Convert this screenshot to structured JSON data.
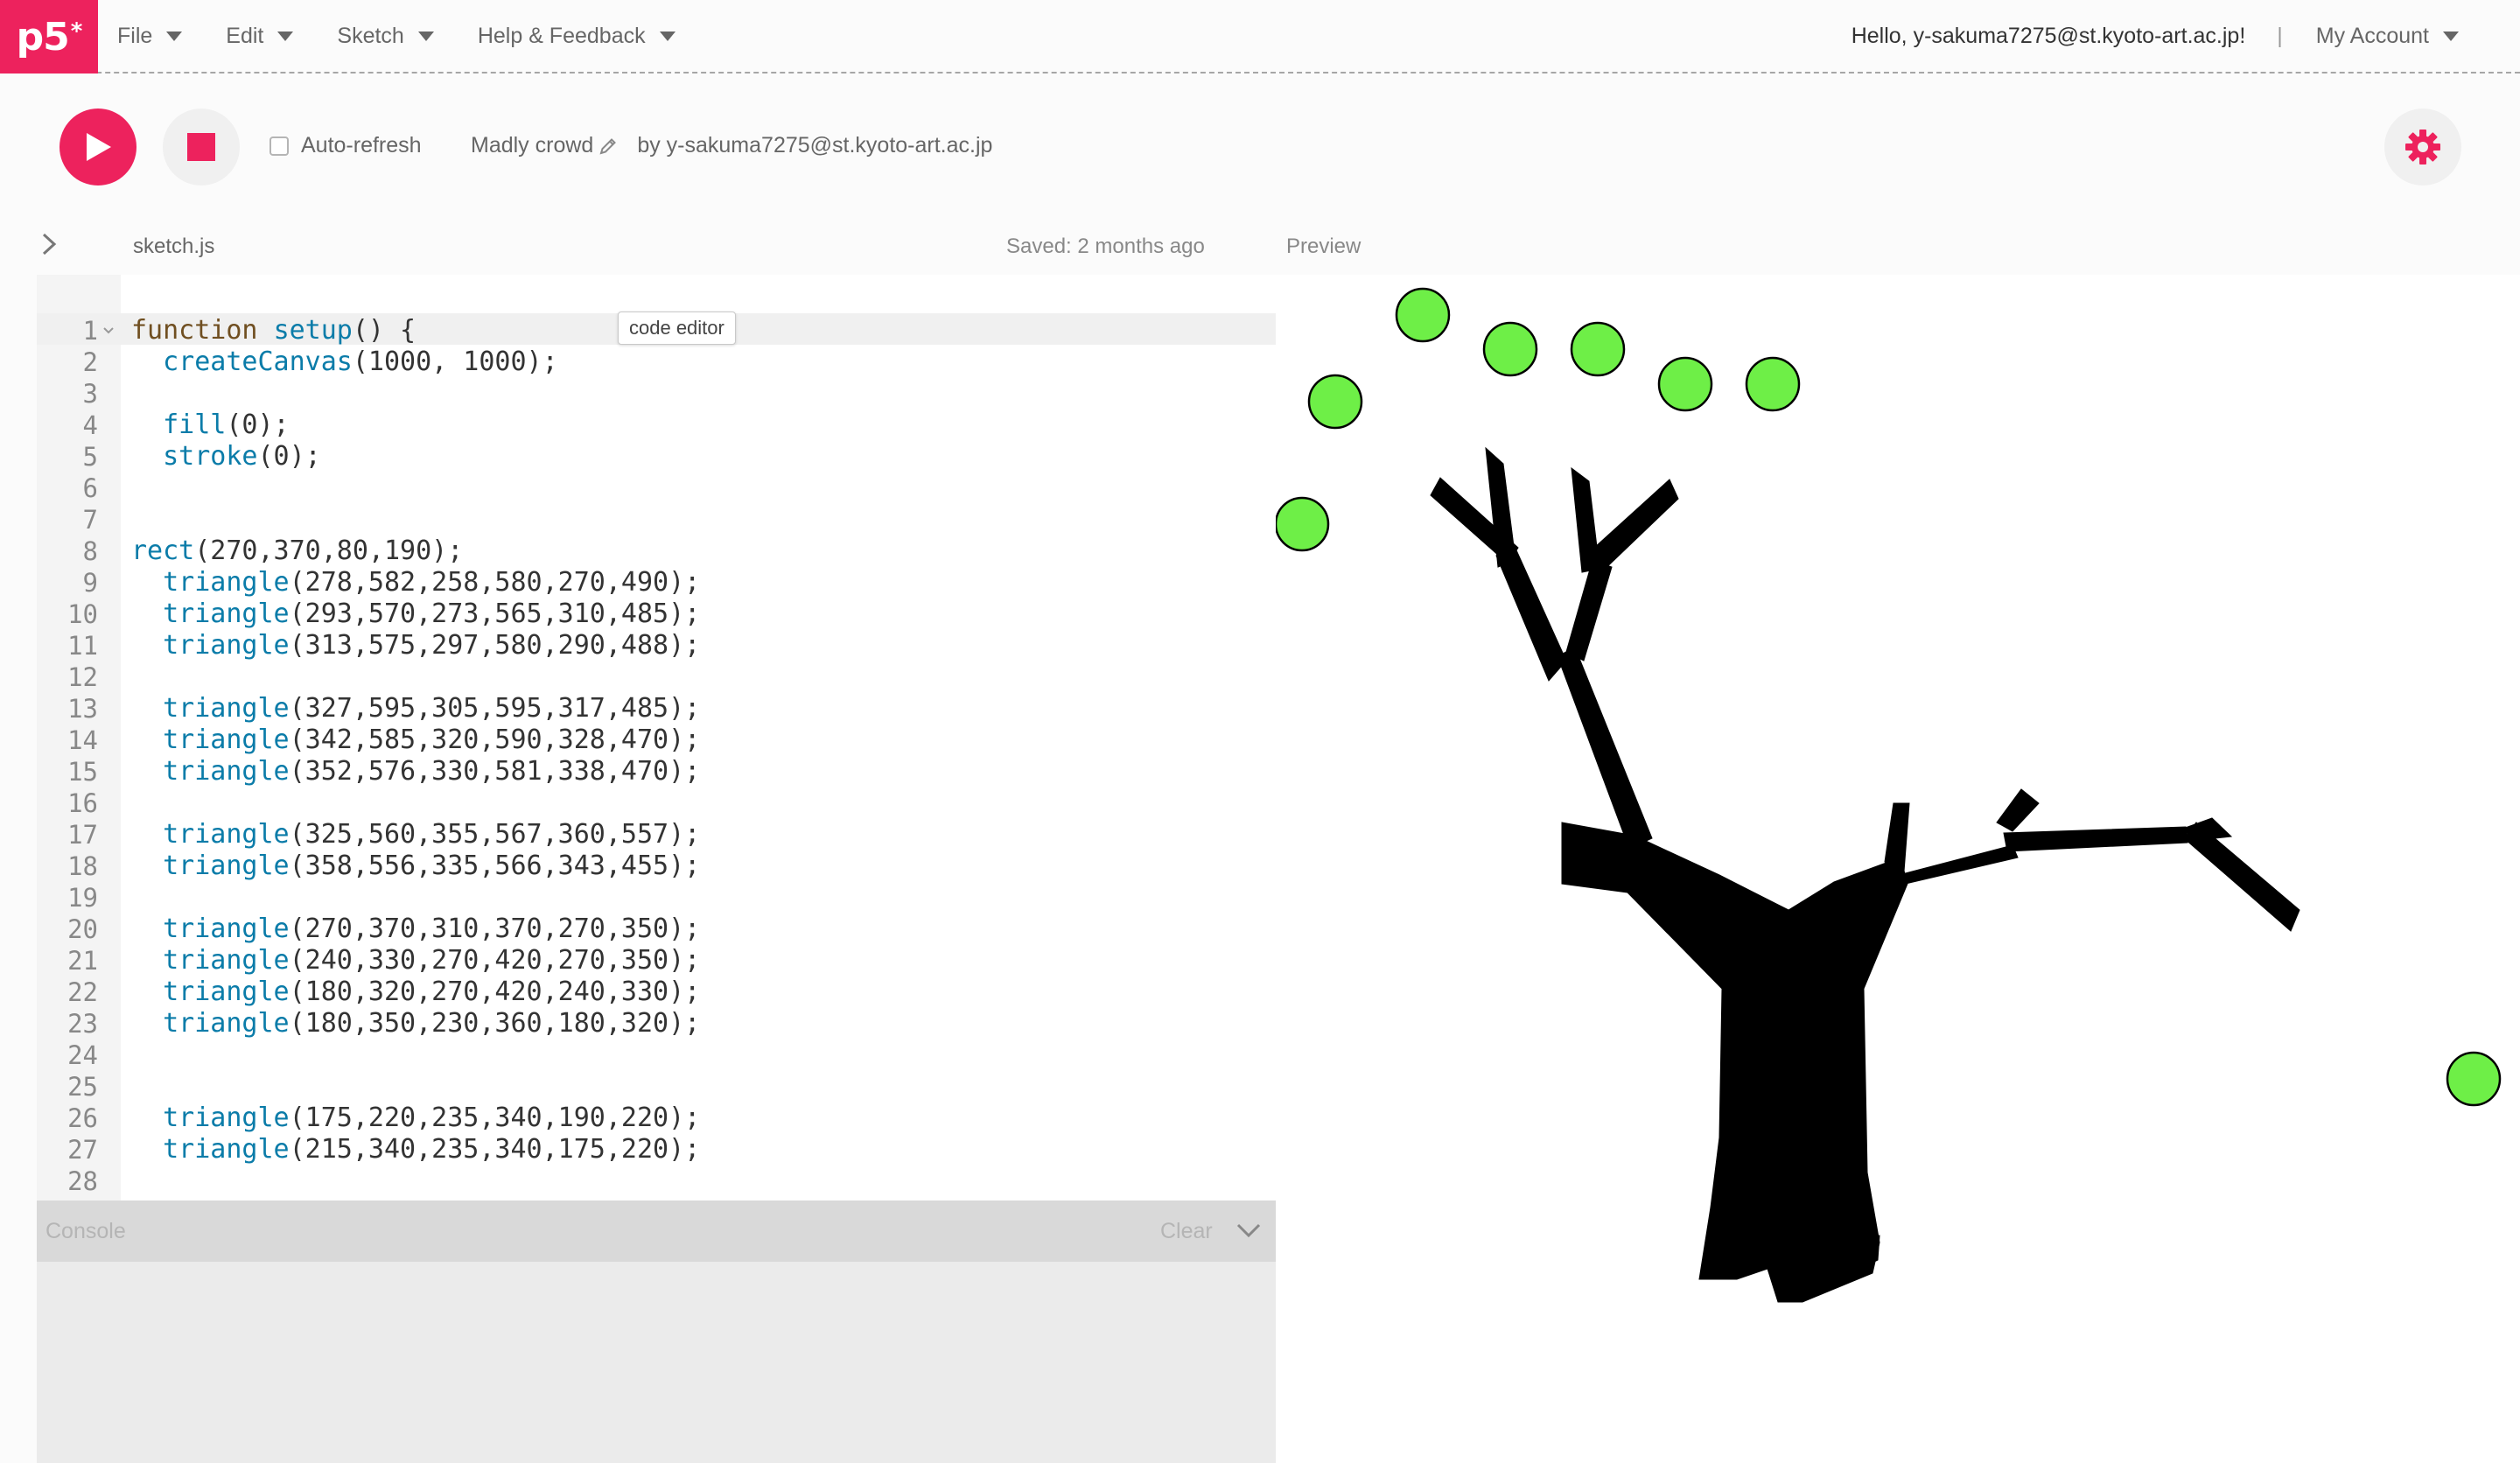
{
  "nav": {
    "logo": "p5",
    "logo_mark": "*",
    "menu": [
      {
        "label": "File"
      },
      {
        "label": "Edit"
      },
      {
        "label": "Sketch"
      },
      {
        "label": "Help & Feedback"
      }
    ],
    "greeting": "Hello, y-sakuma7275@st.kyoto-art.ac.jp!",
    "divider": "|",
    "account_label": "My Account"
  },
  "toolbar": {
    "auto_refresh_label": "Auto-refresh",
    "auto_refresh_checked": false,
    "sketch_name": "Madly crowd",
    "owner": "by y-sakuma7275@st.kyoto-art.ac.jp"
  },
  "editor": {
    "file_name": "sketch.js",
    "saved_status": "Saved: 2 months ago",
    "tooltip": "code editor",
    "lines": [
      "function setup() {",
      "  createCanvas(1000, 1000);",
      "",
      "  fill(0);",
      "  stroke(0);",
      "",
      "",
      "rect(270,370,80,190);",
      "  triangle(278,582,258,580,270,490);",
      "  triangle(293,570,273,565,310,485);",
      "  triangle(313,575,297,580,290,488);",
      "",
      "  triangle(327,595,305,595,317,485);",
      "  triangle(342,585,320,590,328,470);",
      "  triangle(352,576,330,581,338,470);",
      "",
      "  triangle(325,560,355,567,360,557);",
      "  triangle(358,556,335,566,343,455);",
      "",
      "  triangle(270,370,310,370,270,350);",
      "  triangle(240,330,270,420,270,350);",
      "  triangle(180,320,270,420,240,330);",
      "  triangle(180,350,230,360,180,320);",
      "",
      "",
      "  triangle(175,220,235,340,190,220);",
      "  triangle(215,340,235,340,175,220);",
      ""
    ]
  },
  "console": {
    "title": "Console",
    "clear_label": "Clear"
  },
  "preview": {
    "label": "Preview"
  },
  "colors": {
    "accent": "#ed225d",
    "circle_fill": "#6eef47",
    "keyword": "#704f21",
    "function": "#0b7ca9"
  },
  "icons": [
    "play-icon",
    "stop-icon",
    "pencil-icon",
    "gear-icon",
    "chevron-right-icon",
    "chevron-down-icon",
    "fold-arrow-icon"
  ]
}
